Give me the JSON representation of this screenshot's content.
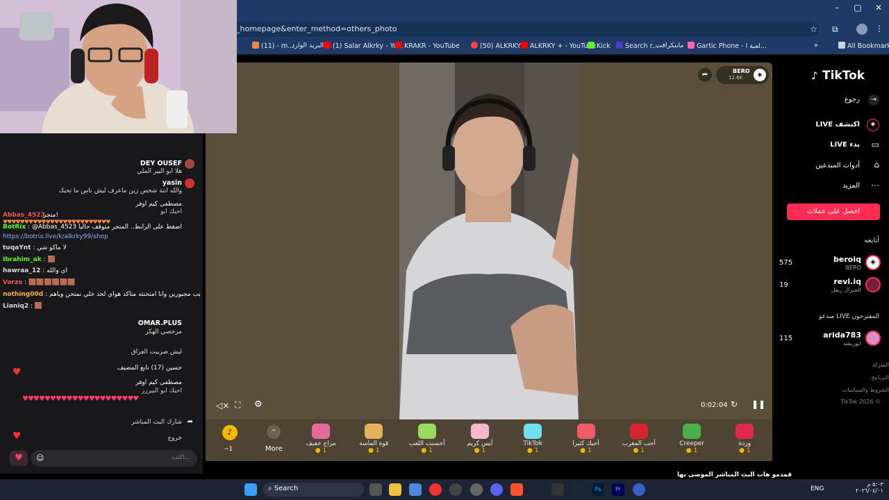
{
  "browser": {
    "url": "_homepage&enter_method=others_photo",
    "bookmarks": [
      "(11) - m...",
      "البريد الوارد",
      "(1) Salar Alkrky - Yo...",
      "KRAKR - YouTube",
      "(50) ALKRKY",
      "ALKRKY + - YouTube",
      "Kick",
      "Search r...",
      "ماينكرافت",
      "Gartic Phone - لعبة ا..."
    ],
    "all_bookmarks": "All Bookmarks",
    "colors": {
      "frame": "#1f3a66",
      "accent": "#fe2c55"
    }
  },
  "chat": {
    "messages": [
      {
        "user": "DEY OUSEF",
        "text": "هلا ابو البير الملي"
      },
      {
        "user": "yasin",
        "text": "والله انتة شخص زين ماعرف ليش ناس ما تحبك"
      },
      {
        "user": "مصطفى كيم اوفر",
        "text": "احبك ابو"
      },
      {
        "user": "Abbas_4523",
        "text": "متجر!"
      },
      {
        "user": "BotRix",
        "text": "@Abbas_4523 اضغط على الرابط.. المتجر متوقف حاليا"
      },
      {
        "user": "",
        "text": "https://botrix.live/k/alkrky99/shop"
      },
      {
        "user": "tuqaYnt",
        "text": "لا ماكو شي"
      },
      {
        "user": "Ibrahim_ak",
        "text": "🟫"
      },
      {
        "user": "hawraa_12",
        "text": "اي والله"
      },
      {
        "user": "Varzo",
        "text": "🟫🟫🟫🟫🟫🟫"
      },
      {
        "user": "nothing00d",
        "text": "الوييييب مجبورين وانا امتحنته متأكد هواي لحد خلي نمتحن وياهم"
      },
      {
        "user": "Lianiq2",
        "text": "🟫"
      },
      {
        "user": "OMAR.PLUS",
        "text": "مرحصي الهكر"
      },
      {
        "user": "",
        "text": "ليش ضربيت العراق"
      },
      {
        "user": "حسين (17)",
        "text": "تابع المضيف"
      },
      {
        "user": "مصطفى كيم اوفر",
        "text": "احبك ابو البيررر"
      }
    ],
    "share_label": "شارك البث المباشر",
    "input_placeholder": "اكتب...",
    "exit_label": "خروج"
  },
  "player": {
    "streamer": "BERO",
    "viewers": "12.6K",
    "timer": "0:02:04",
    "more_label": "More",
    "coin_count": "1",
    "gifts": [
      {
        "name": "مزاج خفيف",
        "price": "1",
        "color": "#e86a9c"
      },
      {
        "name": "قوة الماسة",
        "price": "1",
        "color": "#e6b259"
      },
      {
        "name": "أحسنت اللعب",
        "price": "1",
        "color": "#9adb5f"
      },
      {
        "name": "آيس كريم",
        "price": "1",
        "color": "#f7b7cf"
      },
      {
        "name": "TikTok",
        "price": "1",
        "color": "#6fe0f0"
      },
      {
        "name": "أحبك كثيرا",
        "price": "1",
        "color": "#f05b6a"
      },
      {
        "name": "أحب المغرب",
        "price": "1",
        "color": "#d8242c"
      },
      {
        "name": "Creeper",
        "price": "1",
        "color": "#4bb04b"
      },
      {
        "name": "وردة",
        "price": "1",
        "color": "#e0284f"
      }
    ]
  },
  "sidebar": {
    "logo": "TikTok",
    "back": "رجوع",
    "explore": "LIVE اكتشف",
    "go_live": "LIVE بدء",
    "creator_tools": "أدوات المبدعين",
    "more": "المزيد",
    "get_coins": "احصل على عملات",
    "following_title": "أتابعه",
    "following": [
      {
        "name": "beroiq",
        "sub": "BERO",
        "count": "575"
      },
      {
        "name": "revl.iq",
        "sub": "الجنرال ريفل",
        "count": "19"
      }
    ],
    "suggested_title": "مبدعو LIVE المقترحون",
    "suggested": [
      {
        "name": "arida783",
        "sub": "ايوريشه",
        "count": "115"
      }
    ],
    "footer": [
      "الشركة",
      "البرنامج",
      "الشروط والسياسات",
      "TikTok 2026 ©"
    ]
  },
  "page_caption": "قمدمو هات البث المباشر الموصى بها",
  "taskbar": {
    "search": "Search",
    "lang": "ENG",
    "time": "٥:٠٣ م",
    "date": "٢٠٢٦/٠٤/٠١"
  }
}
